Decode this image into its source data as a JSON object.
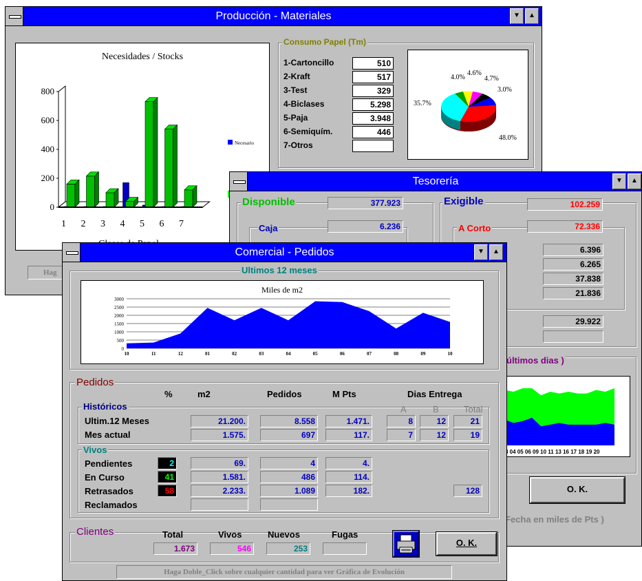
{
  "produccion": {
    "title": "Producción - Materiales",
    "chart_title": "Necesidades / Stocks",
    "y_ticks": [
      "800",
      "600",
      "400",
      "200",
      "0"
    ],
    "x_ticks": [
      "1",
      "2",
      "3",
      "4",
      "5",
      "6",
      "7"
    ],
    "xlabel": "Clases de Papel",
    "legend_label": "Necesario",
    "status_hint": "Hag",
    "consumo_label": "Consumo Papel  (Tm)",
    "materials": [
      {
        "label": "1-Cartoncillo",
        "value": "510"
      },
      {
        "label": "2-Kraft",
        "value": "517"
      },
      {
        "label": "3-Test",
        "value": "329"
      },
      {
        "label": "4-Biclases",
        "value": "5.298"
      },
      {
        "label": "5-Paja",
        "value": "3.948"
      },
      {
        "label": "6-Semiquím.",
        "value": "446"
      },
      {
        "label": "7-Otros",
        "value": ""
      }
    ],
    "pie_labels": {
      "a": "4.0%",
      "b": "4.6%",
      "c": "4.7%",
      "d": "3.0%",
      "e": "35.7%",
      "f": "48.0%"
    }
  },
  "tesoreria": {
    "title": "Tesorería",
    "disponible_label": "Disponible",
    "disponible_value": "377.923",
    "caja_label": "Caja",
    "caja_value": "6.236",
    "exigible_label": "Exigible",
    "exigible_value": "102.259",
    "acorto_label": "A Corto",
    "acorto_value": "72.336",
    "values": [
      "6.396",
      "6.265",
      "37.838",
      "21.836"
    ],
    "value_extra": "29.922",
    "ultimos_label": "últimos dias )",
    "x_ticks": "3 04 05 06 09 10 11  13 16 17  18 19 20",
    "ok_label": "O. K.",
    "footer": "Fecha en miles de Pts )"
  },
  "comercial": {
    "title": "Comercial - Pedidos",
    "ultimos_label": "Ultimos 12 meses",
    "chart_title": "Miles de m2",
    "pedidos_label": "Pedidos",
    "col_pct": "%",
    "col_m2": "m2",
    "col_pedidos": "Pedidos",
    "col_mpts": "M Pts",
    "col_dias": "Dias  Entrega",
    "historicos_label": "Históricos",
    "sub_a": "A",
    "sub_b": "B",
    "sub_total": "Total",
    "ultim_label": "Ultim.12 Meses",
    "ultim": {
      "m2": "21.200.",
      "pedidos": "8.558",
      "mpts": "1.471.",
      "a": "8",
      "b": "12",
      "total": "21"
    },
    "mes_label": "Mes actual",
    "mes": {
      "m2": "1.575.",
      "pedidos": "697",
      "mpts": "117.",
      "a": "7",
      "b": "12",
      "total": "19"
    },
    "vivos_label": "Vivos",
    "pendientes_label": "Pendientes",
    "pendientes": {
      "pct": "2",
      "m2": "69.",
      "pedidos": "4",
      "mpts": "4."
    },
    "encurso_label": "En Curso",
    "encurso": {
      "pct": "41",
      "m2": "1.581.",
      "pedidos": "486",
      "mpts": "114."
    },
    "retrasados_label": "Retrasados",
    "retrasados": {
      "pct": "58",
      "m2": "2.233.",
      "pedidos": "1.089",
      "mpts": "182.",
      "total": "128"
    },
    "reclamados_label": "Reclamados",
    "clientes_label": "Clientes",
    "cl_total_label": "Total",
    "cl_vivos_label": "Vivos",
    "cl_nuevos_label": "Nuevos",
    "cl_fugas_label": "Fugas",
    "cl_total": "1.673",
    "cl_vivos": "546",
    "cl_nuevos": "253",
    "cl_fugas": "",
    "ok_label": "O. K.",
    "hint": "Haga Doble_Click sobre cualquier cantidad para ver Gráfica de Evolución",
    "printer_icon": "printer-icon"
  },
  "colors": {
    "title_bar": "#0000ff",
    "bar_green": "#00c000",
    "bar_blue": "#0000c0",
    "area_blue": "#0000ff",
    "area_green": "#00ff00"
  },
  "chart_data": [
    {
      "type": "bar",
      "title": "Necesidades / Stocks",
      "xlabel": "Clases de Papel",
      "categories": [
        "1",
        "2",
        "3",
        "4",
        "5",
        "6",
        "7"
      ],
      "series": [
        {
          "name": "Necesario",
          "values": [
            5,
            5,
            5,
            170,
            15,
            5,
            5
          ]
        },
        {
          "name": "",
          "values": [
            160,
            215,
            100,
            40,
            730,
            540,
            120
          ]
        }
      ],
      "ylim": [
        0,
        800
      ]
    },
    {
      "type": "pie",
      "categories": [
        "1",
        "2",
        "3",
        "4",
        "5",
        "6"
      ],
      "values": [
        3.0,
        48.0,
        35.7,
        4.0,
        4.6,
        4.7
      ]
    },
    {
      "type": "area",
      "title": "Miles de m2",
      "categories": [
        "10",
        "11",
        "12",
        "01",
        "02",
        "03",
        "04",
        "05",
        "06",
        "07",
        "08",
        "09",
        "10"
      ],
      "values": [
        300,
        350,
        900,
        2450,
        1700,
        2450,
        1700,
        2850,
        2800,
        2250,
        1200,
        2150,
        1600
      ],
      "ylim": [
        0,
        3000
      ],
      "y_ticks": [
        0,
        500,
        1000,
        1500,
        2000,
        2500,
        3000
      ]
    },
    {
      "type": "area",
      "series": [
        {
          "name": "",
          "values": [
            1500,
            1300,
            1400,
            1600,
            1100,
            1200,
            1300,
            1200,
            1200,
            1200,
            1200,
            1300,
            1200
          ]
        },
        {
          "name": "",
          "values": [
            3200,
            3100,
            3300,
            3300,
            2900,
            3100,
            3000,
            3100,
            3000,
            3000,
            3200,
            3100,
            3300
          ]
        }
      ]
    }
  ]
}
